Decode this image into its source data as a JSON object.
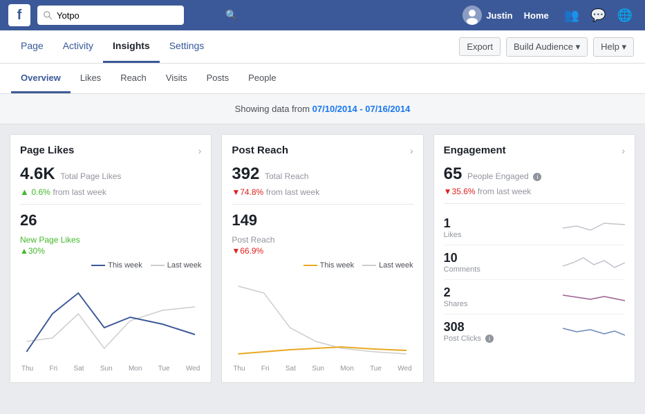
{
  "topnav": {
    "logo": "f",
    "search_placeholder": "Yotpo",
    "username": "Justin",
    "home_label": "Home"
  },
  "pagenav": {
    "items": [
      {
        "label": "Page",
        "active": false
      },
      {
        "label": "Activity",
        "active": false
      },
      {
        "label": "Insights",
        "active": true
      },
      {
        "label": "Settings",
        "active": false
      }
    ],
    "export_label": "Export",
    "build_audience_label": "Build Audience ▾",
    "help_label": "Help ▾"
  },
  "subnav": {
    "items": [
      {
        "label": "Overview",
        "active": true
      },
      {
        "label": "Likes",
        "active": false
      },
      {
        "label": "Reach",
        "active": false
      },
      {
        "label": "Visits",
        "active": false
      },
      {
        "label": "Posts",
        "active": false
      },
      {
        "label": "People",
        "active": false
      }
    ]
  },
  "data_notice": {
    "text": "Showing data from ",
    "date_range": "07/10/2014 - 07/16/2014"
  },
  "page_likes_card": {
    "title": "Page Likes",
    "total_likes_num": "4.6K",
    "total_likes_label": "Total Page Likes",
    "change_pct": "0.6%",
    "change_dir": "up",
    "change_label": "from last week",
    "new_likes_num": "26",
    "new_likes_label": "New Page Likes",
    "new_change": "▲30%",
    "legend_this": "This week",
    "legend_last": "Last week",
    "x_labels": [
      "Thu",
      "Fri",
      "Sat",
      "Sun",
      "Mon",
      "Tue",
      "Wed"
    ]
  },
  "post_reach_card": {
    "title": "Post Reach",
    "total_reach_num": "392",
    "total_reach_label": "Total Reach",
    "change_pct": "▼74.8%",
    "change_label": "from last week",
    "post_reach_num": "149",
    "post_reach_label": "Post Reach",
    "post_change": "▼66.9%",
    "legend_this": "This week",
    "legend_last": "Last week",
    "x_labels": [
      "Thu",
      "Fri",
      "Sat",
      "Sun",
      "Mon",
      "Tue",
      "Wed"
    ]
  },
  "engagement_card": {
    "title": "Engagement",
    "people_engaged_num": "65",
    "people_engaged_label": "People Engaged",
    "people_change": "▼35.6%",
    "people_change_label": "from last week",
    "rows": [
      {
        "num": "1",
        "label": "Likes"
      },
      {
        "num": "10",
        "label": "Comments"
      },
      {
        "num": "2",
        "label": "Shares"
      },
      {
        "num": "308",
        "label": "Post Clicks"
      }
    ]
  }
}
